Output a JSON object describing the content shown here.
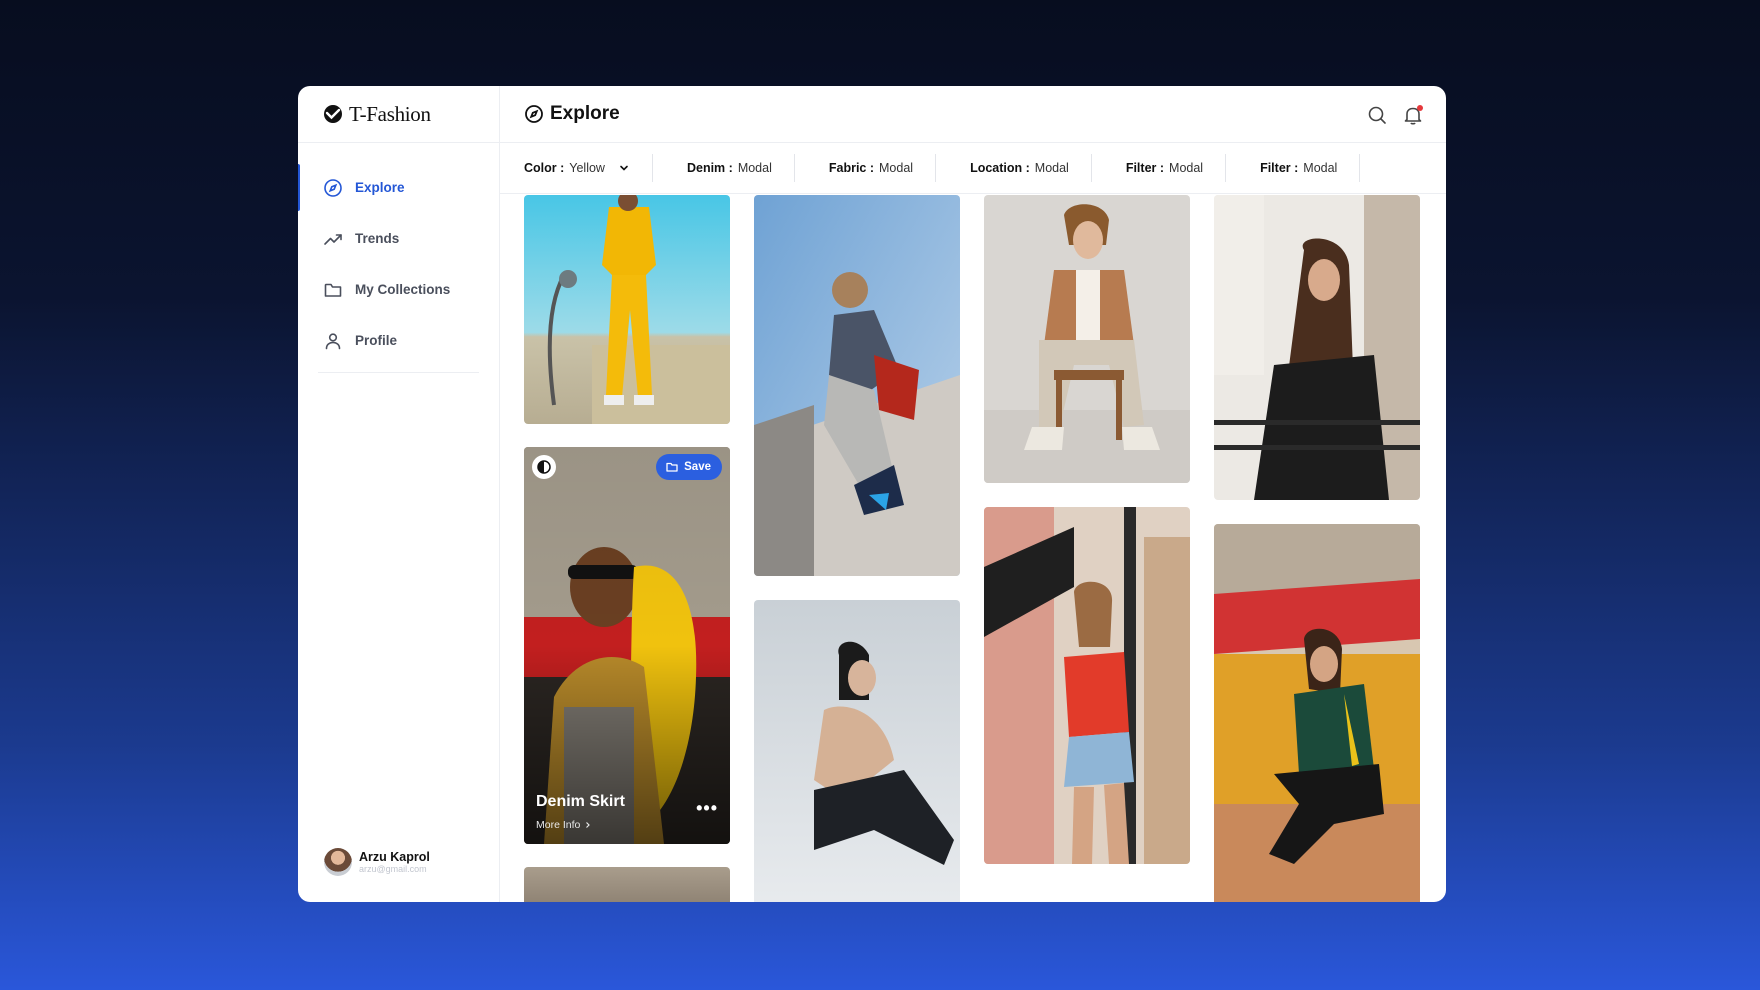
{
  "app": {
    "name": "T-Fashion"
  },
  "header": {
    "title": "Explore"
  },
  "sidebar": {
    "items": [
      {
        "label": "Explore",
        "icon": "compass-icon",
        "active": true
      },
      {
        "label": "Trends",
        "icon": "trend-up-icon",
        "active": false
      },
      {
        "label": "My Collections",
        "icon": "folder-icon",
        "active": false
      },
      {
        "label": "Profile",
        "icon": "user-icon",
        "active": false
      }
    ]
  },
  "user": {
    "name": "Arzu Kaprol",
    "email": "arzu@gmail.com"
  },
  "filters": [
    {
      "label": "Color :",
      "value": "Yellow",
      "has_dropdown": true
    },
    {
      "label": "Denim :",
      "value": "Modal"
    },
    {
      "label": "Fabric :",
      "value": "Modal"
    },
    {
      "label": "Location :",
      "value": "Modal"
    },
    {
      "label": "Filter :",
      "value": "Modal"
    },
    {
      "label": "Filter :",
      "value": "Modal"
    }
  ],
  "gallery": {
    "featured_card": {
      "title": "Denim Skirt",
      "more_label": "More Info",
      "save_label": "Save",
      "more_actions": "•••"
    }
  },
  "colors": {
    "accent": "#2457d6",
    "save_button": "#2b5fe0",
    "notification_dot": "#e5383b"
  }
}
